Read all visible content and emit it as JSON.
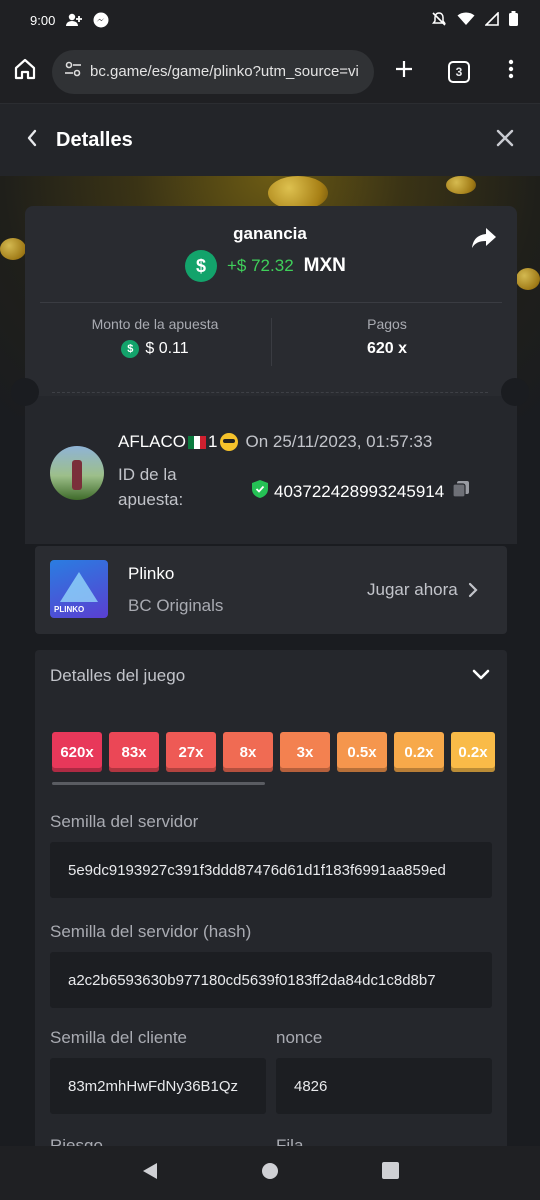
{
  "status_bar": {
    "time": "9:00"
  },
  "browser": {
    "url": "bc.game/es/game/plinko?utm_source=viplu",
    "tab_count": "3"
  },
  "header": {
    "title": "Detalles"
  },
  "win": {
    "title": "ganancia",
    "amount": "+$ 72.32",
    "currency": "MXN"
  },
  "stats": {
    "bet_label": "Monto de la apuesta",
    "bet_value": "$ 0.11",
    "payout_label": "Pagos",
    "payout_value": "620 x"
  },
  "bet": {
    "username": "AFLACO",
    "username_suffix": "1",
    "date": "On 25/11/2023, 01:57:33",
    "id_label": "ID de la apuesta:",
    "id_value": "403722428993245914"
  },
  "game": {
    "name": "Plinko",
    "provider": "BC Originals",
    "play_label": "Jugar ahora",
    "thumb_label": "PLINKO"
  },
  "details": {
    "title": "Detalles del juego",
    "multipliers": [
      {
        "label": "620x",
        "color": "#e8385a"
      },
      {
        "label": "83x",
        "color": "#eb4756"
      },
      {
        "label": "27x",
        "color": "#ee5a55"
      },
      {
        "label": "8x",
        "color": "#f06b53"
      },
      {
        "label": "3x",
        "color": "#f38150"
      },
      {
        "label": "0.5x",
        "color": "#f5964d"
      },
      {
        "label": "0.2x",
        "color": "#f7a94a"
      },
      {
        "label": "0.2x",
        "color": "#f9bb48"
      }
    ],
    "server_seed_label": "Semilla del servidor",
    "server_seed": "5e9dc9193927c391f3ddd87476d61d1f183f6991aa859ed",
    "server_hash_label": "Semilla del servidor (hash)",
    "server_hash": "a2c2b6593630b977180cd5639f0183ff2da84dc1c8d8b7",
    "client_seed_label": "Semilla del cliente",
    "client_seed": "83m2mhHwFdNy36B1Qz",
    "nonce_label": "nonce",
    "nonce": "4826",
    "risk_label": "Riesgo",
    "row_label": "Fila"
  }
}
